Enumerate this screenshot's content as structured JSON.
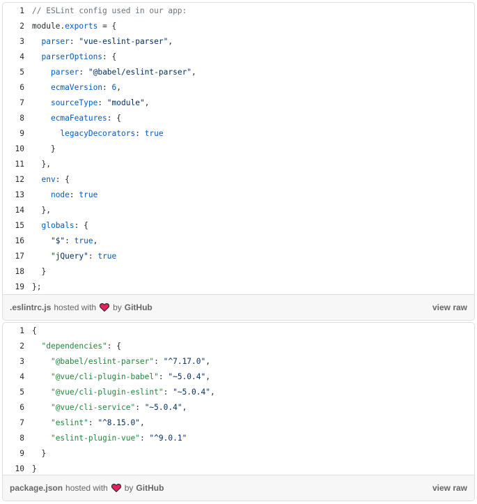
{
  "gists": [
    {
      "filename": ".eslintrc.js",
      "hosted_with": "hosted with",
      "by": "by",
      "github": "GitHub",
      "view_raw": "view raw",
      "lines": [
        {
          "n": "1",
          "tokens": [
            {
              "t": "// ESLint config used in our app:",
              "c": "com"
            }
          ]
        },
        {
          "n": "2",
          "tokens": [
            {
              "t": "module",
              "c": "plain"
            },
            {
              "t": ".",
              "c": "plain"
            },
            {
              "t": "exports",
              "c": "pro"
            },
            {
              "t": " = {",
              "c": "plain"
            }
          ]
        },
        {
          "n": "3",
          "tokens": [
            {
              "t": "  ",
              "c": "plain"
            },
            {
              "t": "parser",
              "c": "pro"
            },
            {
              "t": ": ",
              "c": "plain"
            },
            {
              "t": "\"vue-eslint-parser\"",
              "c": "str"
            },
            {
              "t": ",",
              "c": "plain"
            }
          ]
        },
        {
          "n": "4",
          "tokens": [
            {
              "t": "  ",
              "c": "plain"
            },
            {
              "t": "parserOptions",
              "c": "pro"
            },
            {
              "t": ": {",
              "c": "plain"
            }
          ]
        },
        {
          "n": "5",
          "tokens": [
            {
              "t": "    ",
              "c": "plain"
            },
            {
              "t": "parser",
              "c": "pro"
            },
            {
              "t": ": ",
              "c": "plain"
            },
            {
              "t": "\"@babel/eslint-parser\"",
              "c": "str"
            },
            {
              "t": ",",
              "c": "plain"
            }
          ]
        },
        {
          "n": "6",
          "tokens": [
            {
              "t": "    ",
              "c": "plain"
            },
            {
              "t": "ecmaVersion",
              "c": "pro"
            },
            {
              "t": ": ",
              "c": "plain"
            },
            {
              "t": "6",
              "c": "num"
            },
            {
              "t": ",",
              "c": "plain"
            }
          ]
        },
        {
          "n": "7",
          "tokens": [
            {
              "t": "    ",
              "c": "plain"
            },
            {
              "t": "sourceType",
              "c": "pro"
            },
            {
              "t": ": ",
              "c": "plain"
            },
            {
              "t": "\"module\"",
              "c": "str"
            },
            {
              "t": ",",
              "c": "plain"
            }
          ]
        },
        {
          "n": "8",
          "tokens": [
            {
              "t": "    ",
              "c": "plain"
            },
            {
              "t": "ecmaFeatures",
              "c": "pro"
            },
            {
              "t": ": {",
              "c": "plain"
            }
          ]
        },
        {
          "n": "9",
          "tokens": [
            {
              "t": "      ",
              "c": "plain"
            },
            {
              "t": "legacyDecorators",
              "c": "pro"
            },
            {
              "t": ": ",
              "c": "plain"
            },
            {
              "t": "true",
              "c": "kw"
            }
          ]
        },
        {
          "n": "10",
          "tokens": [
            {
              "t": "    }",
              "c": "plain"
            }
          ]
        },
        {
          "n": "11",
          "tokens": [
            {
              "t": "  },",
              "c": "plain"
            }
          ]
        },
        {
          "n": "12",
          "tokens": [
            {
              "t": "  ",
              "c": "plain"
            },
            {
              "t": "env",
              "c": "pro"
            },
            {
              "t": ": {",
              "c": "plain"
            }
          ]
        },
        {
          "n": "13",
          "tokens": [
            {
              "t": "    ",
              "c": "plain"
            },
            {
              "t": "node",
              "c": "pro"
            },
            {
              "t": ": ",
              "c": "plain"
            },
            {
              "t": "true",
              "c": "kw"
            }
          ]
        },
        {
          "n": "14",
          "tokens": [
            {
              "t": "  },",
              "c": "plain"
            }
          ]
        },
        {
          "n": "15",
          "tokens": [
            {
              "t": "  ",
              "c": "plain"
            },
            {
              "t": "globals",
              "c": "pro"
            },
            {
              "t": ": {",
              "c": "plain"
            }
          ]
        },
        {
          "n": "16",
          "tokens": [
            {
              "t": "    ",
              "c": "plain"
            },
            {
              "t": "\"$\"",
              "c": "str"
            },
            {
              "t": ": ",
              "c": "plain"
            },
            {
              "t": "true",
              "c": "kw"
            },
            {
              "t": ",",
              "c": "plain"
            }
          ]
        },
        {
          "n": "17",
          "tokens": [
            {
              "t": "    ",
              "c": "plain"
            },
            {
              "t": "\"jQuery\"",
              "c": "str"
            },
            {
              "t": ": ",
              "c": "plain"
            },
            {
              "t": "true",
              "c": "kw"
            }
          ]
        },
        {
          "n": "18",
          "tokens": [
            {
              "t": "  }",
              "c": "plain"
            }
          ]
        },
        {
          "n": "19",
          "tokens": [
            {
              "t": "};",
              "c": "plain"
            }
          ]
        }
      ]
    },
    {
      "filename": "package.json",
      "hosted_with": "hosted with",
      "by": "by",
      "github": "GitHub",
      "view_raw": "view raw",
      "lines": [
        {
          "n": "1",
          "tokens": [
            {
              "t": "{",
              "c": "plain"
            }
          ]
        },
        {
          "n": "2",
          "tokens": [
            {
              "t": "  ",
              "c": "plain"
            },
            {
              "t": "\"dependencies\"",
              "c": "grn"
            },
            {
              "t": ": {",
              "c": "plain"
            }
          ]
        },
        {
          "n": "3",
          "tokens": [
            {
              "t": "    ",
              "c": "plain"
            },
            {
              "t": "\"@babel/eslint-parser\"",
              "c": "grn"
            },
            {
              "t": ": ",
              "c": "plain"
            },
            {
              "t": "\"^7.17.0\"",
              "c": "str"
            },
            {
              "t": ",",
              "c": "plain"
            }
          ]
        },
        {
          "n": "4",
          "tokens": [
            {
              "t": "    ",
              "c": "plain"
            },
            {
              "t": "\"@vue/cli-plugin-babel\"",
              "c": "grn"
            },
            {
              "t": ": ",
              "c": "plain"
            },
            {
              "t": "\"~5.0.4\"",
              "c": "str"
            },
            {
              "t": ",",
              "c": "plain"
            }
          ]
        },
        {
          "n": "5",
          "tokens": [
            {
              "t": "    ",
              "c": "plain"
            },
            {
              "t": "\"@vue/cli-plugin-eslint\"",
              "c": "grn"
            },
            {
              "t": ": ",
              "c": "plain"
            },
            {
              "t": "\"~5.0.4\"",
              "c": "str"
            },
            {
              "t": ",",
              "c": "plain"
            }
          ]
        },
        {
          "n": "6",
          "tokens": [
            {
              "t": "    ",
              "c": "plain"
            },
            {
              "t": "\"@vue/cli-service\"",
              "c": "grn"
            },
            {
              "t": ": ",
              "c": "plain"
            },
            {
              "t": "\"~5.0.4\"",
              "c": "str"
            },
            {
              "t": ",",
              "c": "plain"
            }
          ]
        },
        {
          "n": "7",
          "tokens": [
            {
              "t": "    ",
              "c": "plain"
            },
            {
              "t": "\"eslint\"",
              "c": "grn"
            },
            {
              "t": ": ",
              "c": "plain"
            },
            {
              "t": "\"^8.15.0\"",
              "c": "str"
            },
            {
              "t": ",",
              "c": "plain"
            }
          ]
        },
        {
          "n": "8",
          "tokens": [
            {
              "t": "    ",
              "c": "plain"
            },
            {
              "t": "\"eslint-plugin-vue\"",
              "c": "grn"
            },
            {
              "t": ": ",
              "c": "plain"
            },
            {
              "t": "\"^9.0.1\"",
              "c": "str"
            }
          ]
        },
        {
          "n": "9",
          "tokens": [
            {
              "t": "  }",
              "c": "plain"
            }
          ]
        },
        {
          "n": "10",
          "tokens": [
            {
              "t": "}",
              "c": "plain"
            }
          ]
        }
      ]
    }
  ],
  "colors": {
    "heart": "#e0245e",
    "comment": "#6a737d",
    "property": "#005cc5",
    "string": "#032f62",
    "json_key": "#22863a"
  },
  "icons": {
    "heart": "heart-icon"
  }
}
